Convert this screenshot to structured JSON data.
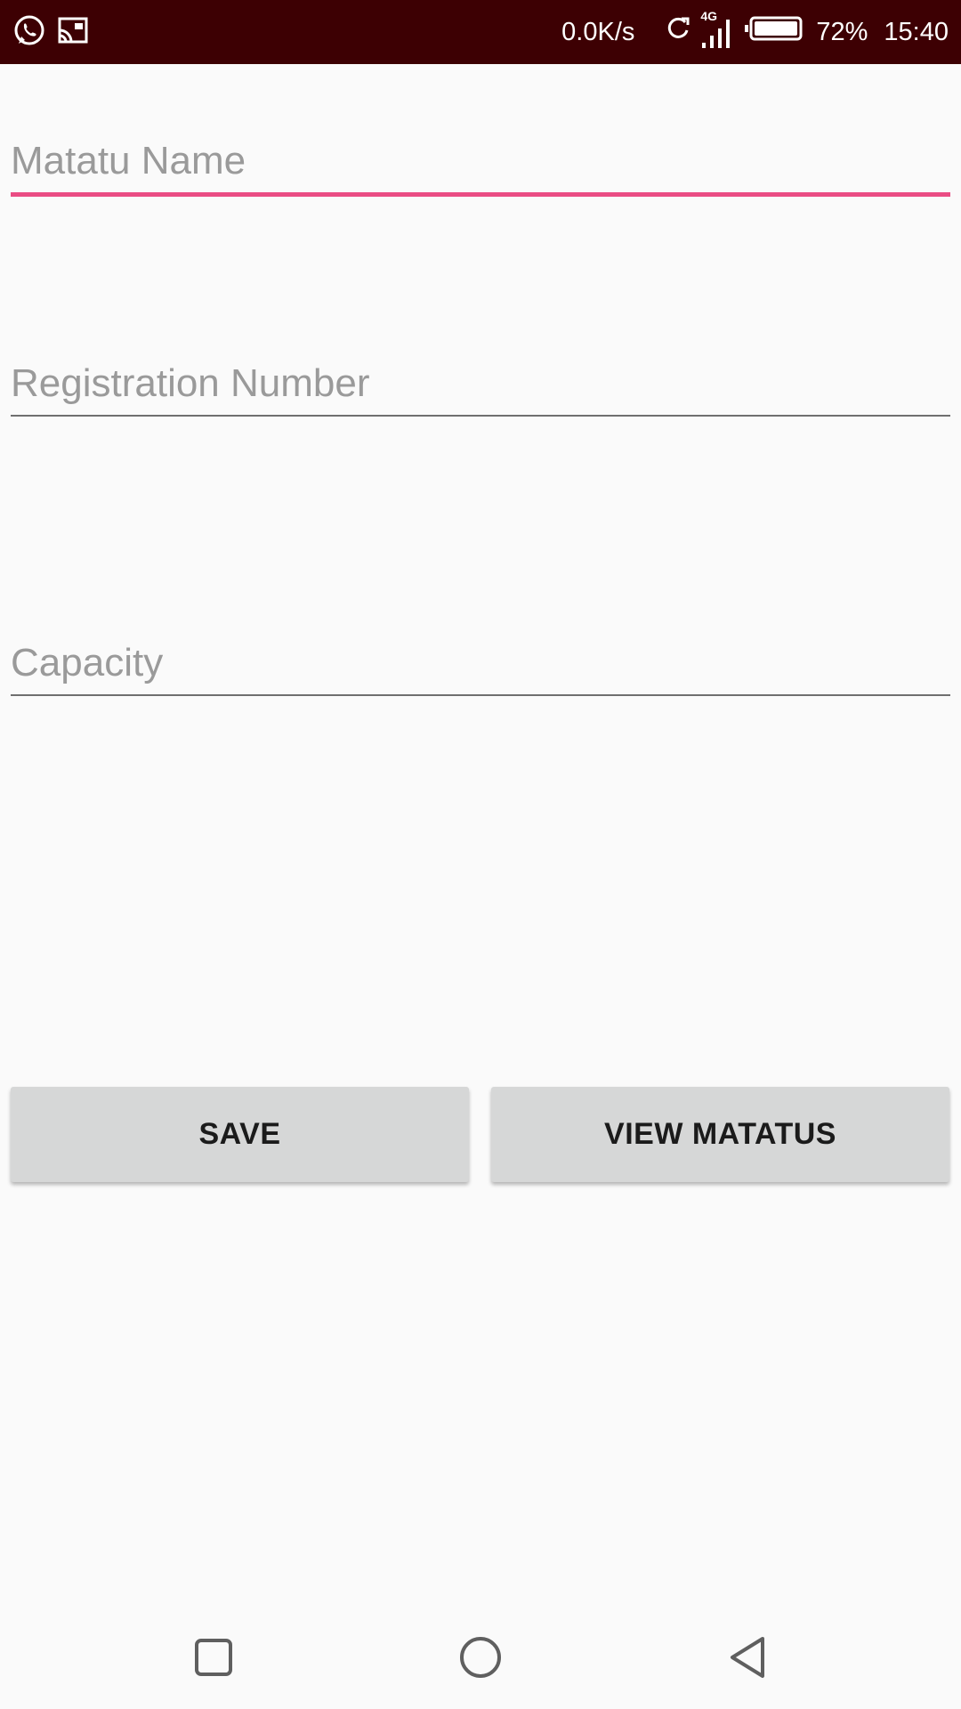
{
  "status_bar": {
    "network_speed": "0.0K/s",
    "network_type": "4G",
    "battery_percent": "72%",
    "time": "15:40",
    "icons": [
      "whatsapp-icon",
      "cast-icon",
      "sync-icon",
      "signal-icon",
      "battery-icon"
    ],
    "background_color": "#3d0003"
  },
  "form": {
    "matatu_name": {
      "value": "",
      "placeholder": "Matatu Name",
      "focused": true
    },
    "registration_number": {
      "value": "",
      "placeholder": "Registration Number"
    },
    "capacity": {
      "value": "",
      "placeholder": "Capacity"
    }
  },
  "actions": {
    "save_label": "SAVE",
    "view_label": "VIEW MATATUS"
  },
  "nav_bar": {
    "icons": [
      "recents-icon",
      "home-icon",
      "back-icon"
    ]
  },
  "colors": {
    "accent": "#ea4c84",
    "button_bg": "#d6d7d7",
    "background": "#fafafa"
  }
}
